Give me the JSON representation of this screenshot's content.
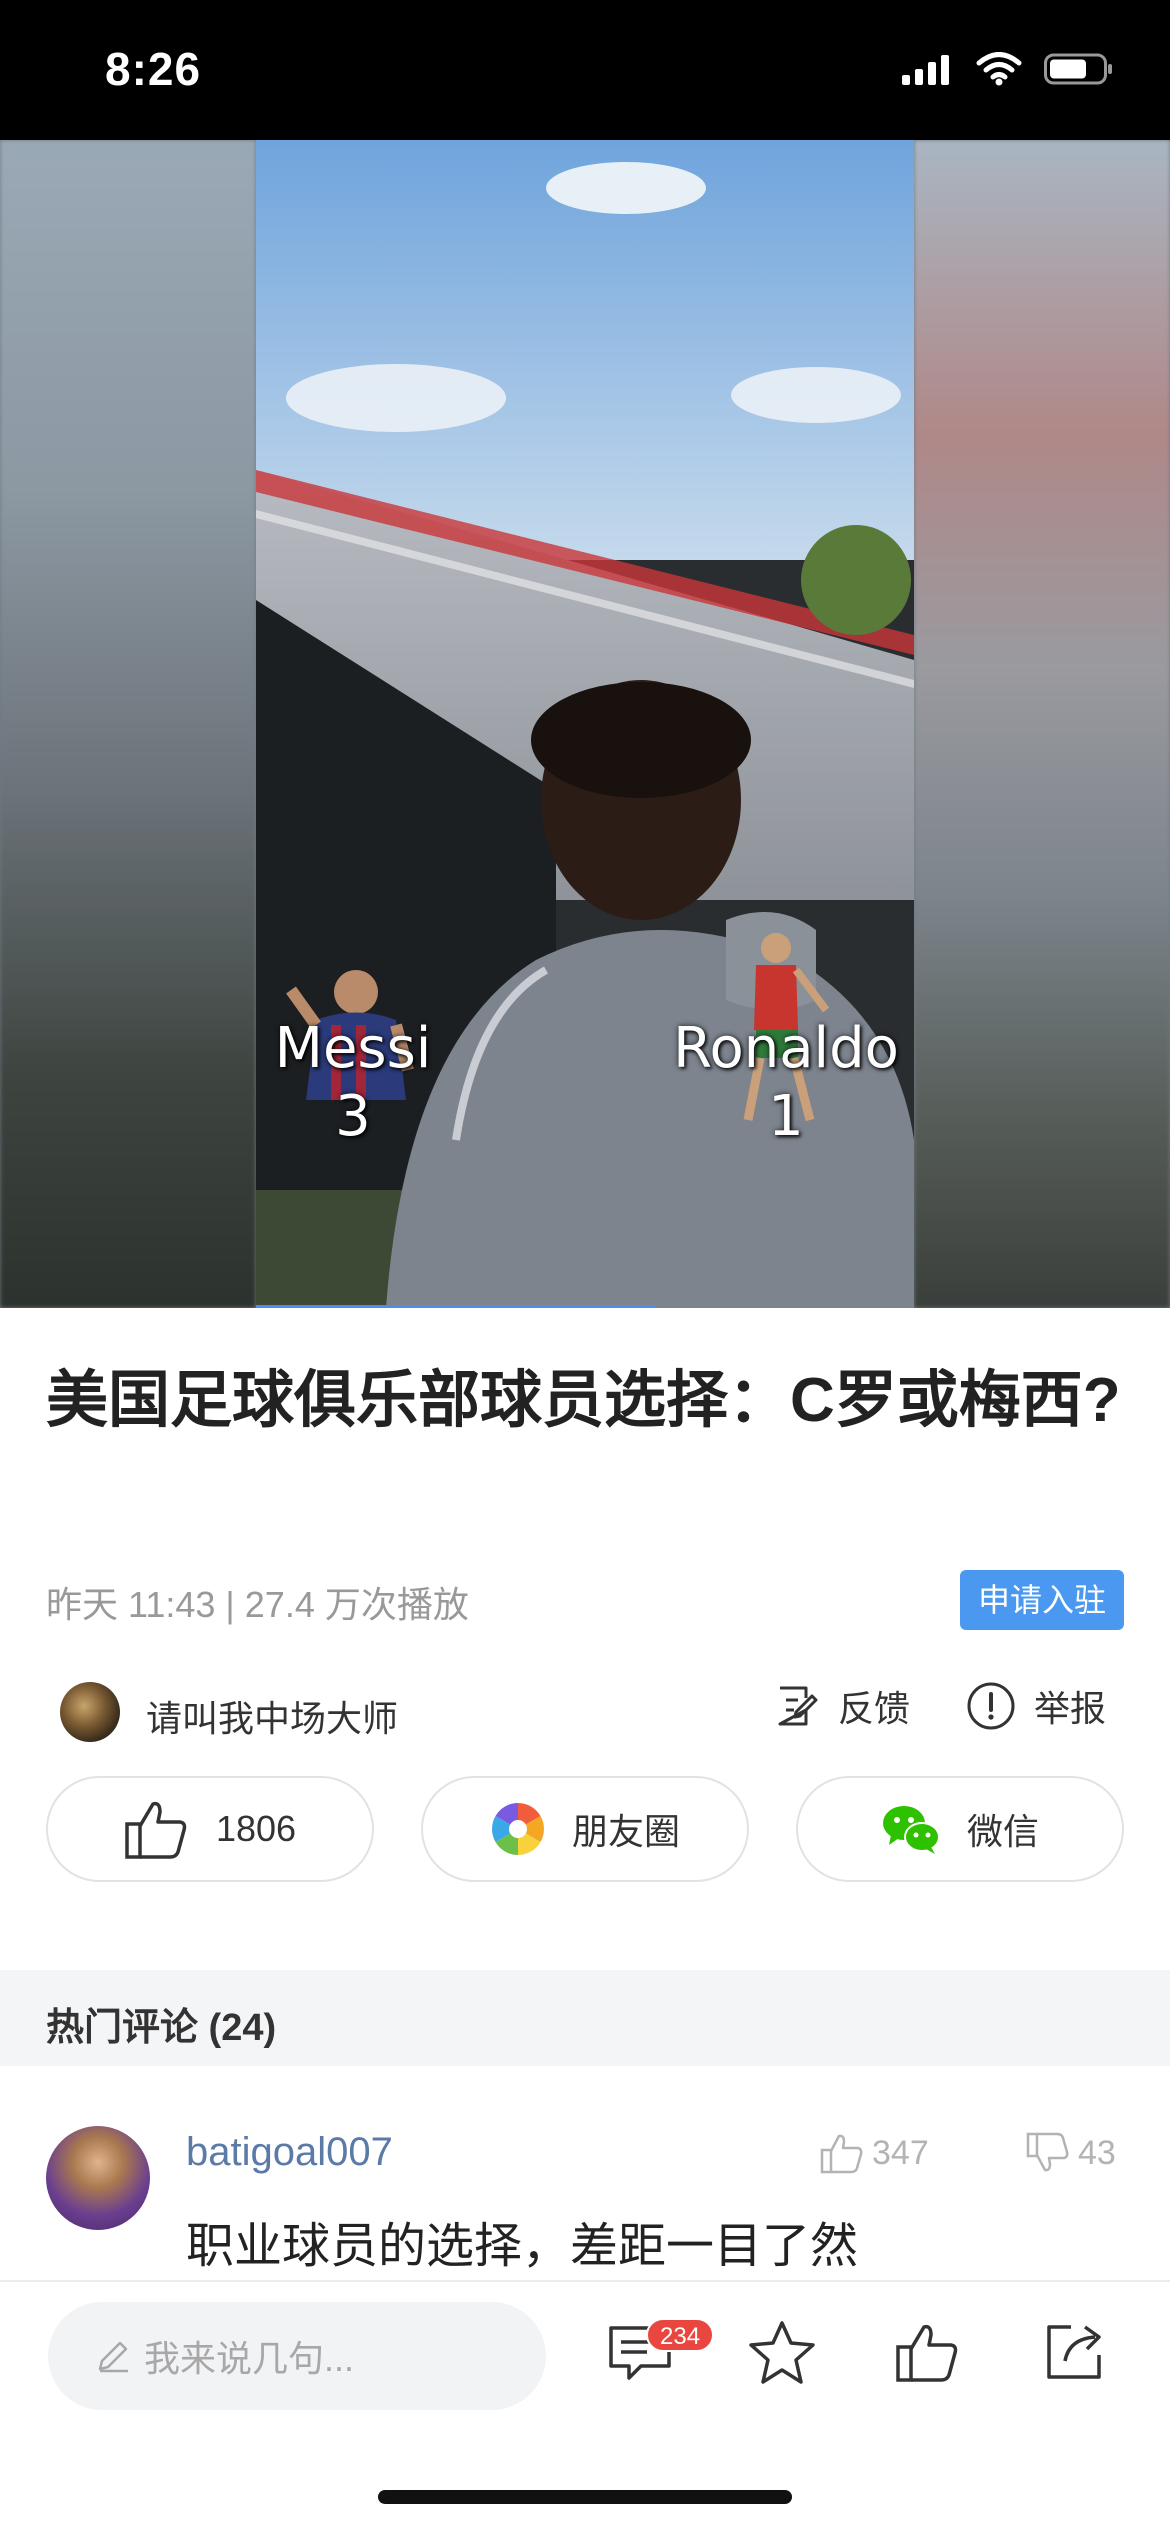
{
  "status_bar": {
    "time": "8:26"
  },
  "video": {
    "left_player": {
      "name": "Messi",
      "count": "3"
    },
    "right_player": {
      "name": "Ronaldo",
      "count": "1"
    }
  },
  "article": {
    "title": "美国足球俱乐部球员选择：C罗或梅西?",
    "meta": "昨天 11:43 | 27.4 万次播放",
    "join_label": "申请入驻"
  },
  "author": {
    "name": "请叫我中场大师"
  },
  "actions": {
    "feedback": "反馈",
    "report": "举报"
  },
  "share": {
    "likes": "1806",
    "moments": "朋友圈",
    "wechat": "微信"
  },
  "comments": {
    "header": "热门评论 (24)",
    "items": [
      {
        "user": "batigoal007",
        "up": "347",
        "down": "43",
        "text": "职业球员的选择，差距一目了然"
      }
    ]
  },
  "bottom_bar": {
    "placeholder": "我来说几句...",
    "comment_count": "234"
  },
  "colors": {
    "accent": "#4a98f0",
    "badge": "#e8463f",
    "username": "#5a7aa8",
    "wechat_green": "#2dc100"
  },
  "icons": [
    "signal-icon",
    "wifi-icon",
    "battery-icon",
    "feedback-icon",
    "report-icon",
    "thumbs-up-icon",
    "moments-icon",
    "wechat-icon",
    "thumbs-down-icon",
    "pencil-icon",
    "comment-icon",
    "star-icon",
    "share-icon"
  ]
}
